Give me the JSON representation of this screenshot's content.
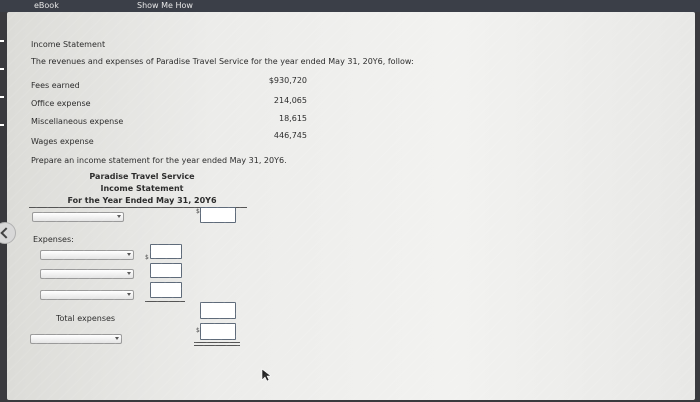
{
  "topbar": {
    "tabs": [
      "eBook",
      "Show Me How"
    ]
  },
  "problem": {
    "heading": "Income Statement",
    "intro": "The revenues and expenses of Paradise Travel Service for the year ended May 31, 20Y6, follow:",
    "items": [
      {
        "label": "Fees earned",
        "value": "$930,720"
      },
      {
        "label": "Office expense",
        "value": "214,065"
      },
      {
        "label": "Miscellaneous expense",
        "value": "18,615"
      },
      {
        "label": "Wages expense",
        "value": "446,745"
      }
    ],
    "instruction": "Prepare an income statement for the year ended May 31, 20Y6."
  },
  "statement": {
    "company": "Paradise Travel Service",
    "title": "Income Statement",
    "period": "For the Year Ended May 31, 20Y6",
    "revenue_select": "",
    "revenue_input": "",
    "expenses_label": "Expenses:",
    "expense_rows": [
      {
        "select": "",
        "input": ""
      },
      {
        "select": "",
        "input": ""
      },
      {
        "select": "",
        "input": ""
      }
    ],
    "total_expenses_label": "Total expenses",
    "total_expenses_input": "",
    "net_select": "",
    "net_input": "",
    "currency_symbol": "$"
  }
}
